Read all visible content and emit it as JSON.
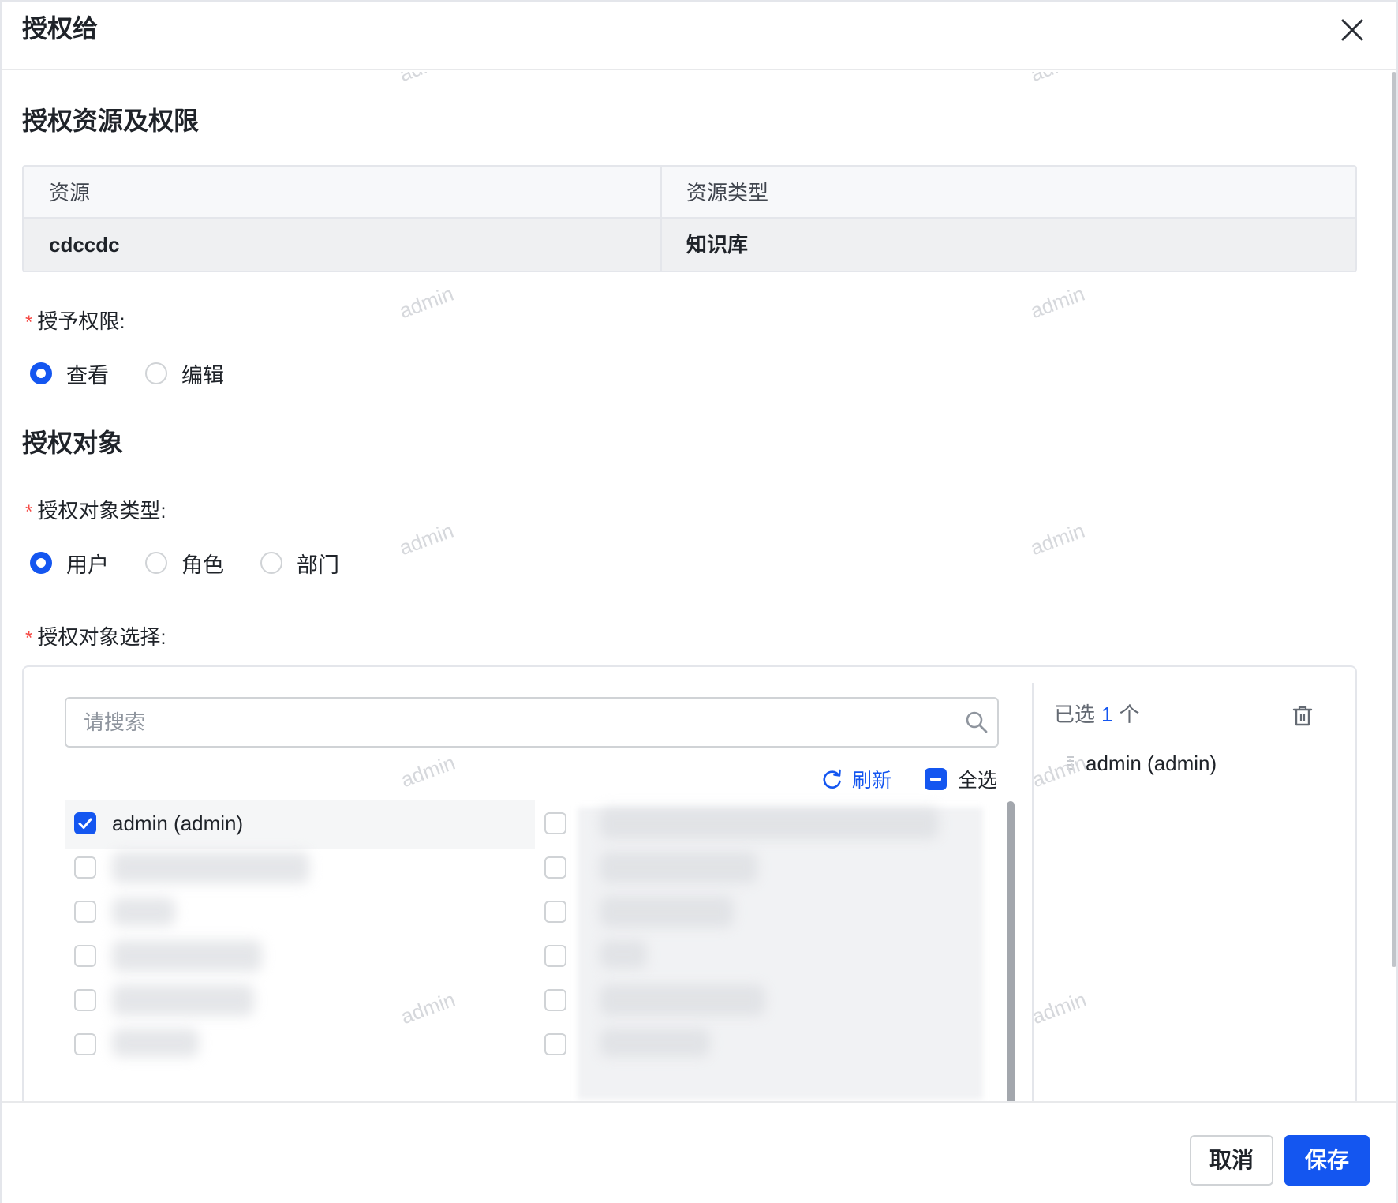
{
  "dialog": {
    "title": "授权给",
    "close_icon": "close-icon"
  },
  "resource_section": {
    "title": "授权资源及权限",
    "table": {
      "columns": [
        "资源",
        "资源类型"
      ],
      "rows": [
        [
          "cdccdc",
          "知识库"
        ]
      ]
    }
  },
  "permission": {
    "required_mark": "*",
    "label": "授予权限:",
    "options": [
      {
        "label": "查看",
        "selected": true
      },
      {
        "label": "编辑",
        "selected": false
      }
    ]
  },
  "target_section": {
    "title": "授权对象",
    "type_field": {
      "required_mark": "*",
      "label": "授权对象类型:",
      "options": [
        {
          "label": "用户",
          "selected": true
        },
        {
          "label": "角色",
          "selected": false
        },
        {
          "label": "部门",
          "selected": false
        }
      ]
    },
    "select_field": {
      "required_mark": "*",
      "label": "授权对象选择:"
    }
  },
  "transfer": {
    "search": {
      "placeholder": "请搜索",
      "value": "",
      "icon": "search-icon"
    },
    "refresh_label": "刷新",
    "refresh_icon": "refresh-icon",
    "select_all_label": "全选",
    "select_all_state": "indeterminate",
    "options": [
      {
        "label": "admin (admin)",
        "checked": true
      }
    ],
    "selected_panel": {
      "prefix": "已选",
      "count": "1",
      "suffix": "个",
      "clear_icon": "trash-icon",
      "items": [
        "admin (admin)"
      ]
    }
  },
  "footer": {
    "cancel_label": "取消",
    "save_label": "保存"
  },
  "watermark": {
    "text": "admin"
  },
  "colors": {
    "accent": "#1456f0",
    "required": "#f54a45",
    "border": "#e4e6eb",
    "text": "#1f2329"
  }
}
